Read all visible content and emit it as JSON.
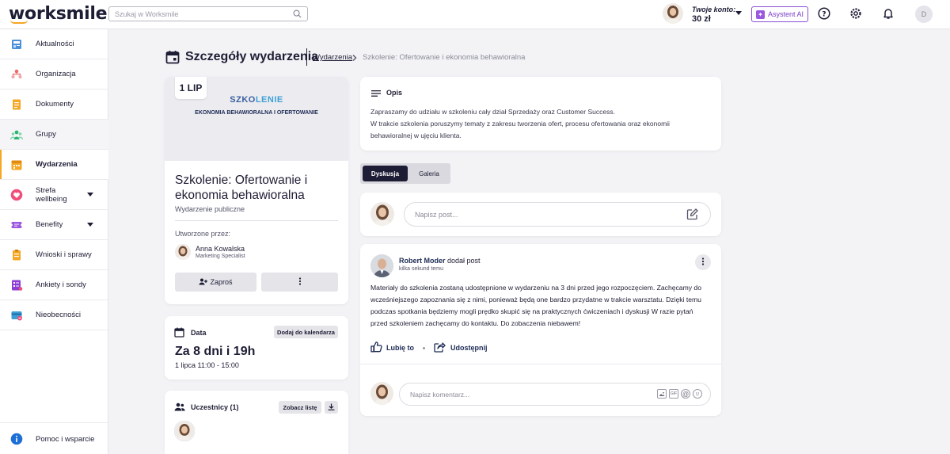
{
  "header": {
    "logo": "worksmile",
    "search_placeholder": "Szukaj w Worksmile",
    "account_label": "Twoje konto:",
    "account_value": "30 zł",
    "ai_button": "Asystent AI",
    "avatar_initial": "D"
  },
  "sidebar": {
    "items": [
      {
        "label": "Aktualności",
        "icon": "newspaper-icon"
      },
      {
        "label": "Organizacja",
        "icon": "org-chart-icon"
      },
      {
        "label": "Dokumenty",
        "icon": "document-icon"
      },
      {
        "label": "Grupy",
        "icon": "group-icon"
      },
      {
        "label": "Wydarzenia",
        "icon": "calendar-icon"
      },
      {
        "label": "Strefa wellbeing",
        "icon": "heart-icon"
      },
      {
        "label": "Benefity",
        "icon": "ticket-icon"
      },
      {
        "label": "Wnioski i sprawy",
        "icon": "clipboard-icon"
      },
      {
        "label": "Ankiety i sondy",
        "icon": "survey-icon"
      },
      {
        "label": "Nieobecności",
        "icon": "absence-icon"
      }
    ],
    "help": "Pomoc i wsparcie"
  },
  "page": {
    "title": "Szczegóły wydarzenia",
    "breadcrumb_link": "Wydarzenia",
    "breadcrumb_current": "Szkolenie: Ofertowanie i ekonomia behawioralna"
  },
  "event": {
    "date_badge": "1 LIP",
    "banner_line1_a": "SZKO",
    "banner_line1_b": "LENIE",
    "banner_line2": "EKONOMIA BEHAWIORALNA I OFERTOWANIE",
    "title": "Szkolenie: Ofertowanie i ekonomia behawioralna",
    "subtitle": "Wydarzenie publiczne",
    "created_by_label": "Utworzone przez:",
    "author_name": "Anna Kowalska",
    "author_role": "Marketing Specialist",
    "invite_button": "Zaproś"
  },
  "date_card": {
    "label": "Data",
    "add_button": "Dodaj do kalendarza",
    "countdown": "Za 8 dni i 19h",
    "time": "1 lipca 11:00 - 15:00"
  },
  "participants": {
    "label": "Uczestnicy (1)",
    "list_button": "Zobacz listę"
  },
  "description": {
    "label": "Opis",
    "line1": "Zapraszamy do udziału w szkoleniu cały dział Sprzedaży oraz Customer Success.",
    "line2": "W trakcie szkolenia poruszymy tematy z zakresu tworzenia ofert, procesu ofertowania oraz ekonomii",
    "line3": "behawioralnej w ujęciu klienta."
  },
  "tabs": {
    "discussion": "Dyskusja",
    "gallery": "Galeria"
  },
  "composer": {
    "placeholder": "Napisz post..."
  },
  "post": {
    "author": "Robert Moder",
    "action": "dodał post",
    "time": "kilka sekund temu",
    "body": "Materiały do szkolenia zostaną udostępnione w wydarzeniu na 3 dni przed jego rozpoczęciem. Zachęcamy do wcześniejszego zapoznania się z nimi, ponieważ będą one bardzo przydatne w trakcie warsztatu. Dzięki temu podczas spotkania będziemy mogli prędko skupić się na praktycznych ćwiczeniach i dyskusji W razie pytań przed szkoleniem zachęcamy do kontaktu. Do zobaczenia niebawem!",
    "like": "Lubię to",
    "share": "Udostępnij",
    "comment_placeholder": "Napisz komentarz..."
  },
  "colors": {
    "accent": "#f5a623",
    "dark": "#1d1d35",
    "ai": "#8b4fd4"
  }
}
